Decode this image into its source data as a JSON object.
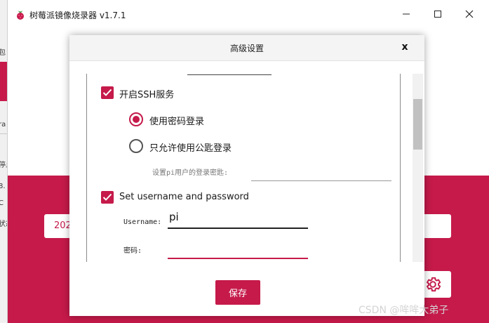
{
  "app": {
    "title": "树莓派镜像烧录器 v1.7.1",
    "icon": "raspberry-icon",
    "colors": {
      "accent": "#c51a4a",
      "background_band": "#c51a4a"
    }
  },
  "window_controls": {
    "minimize": "—",
    "maximize": "☐",
    "close": "✕"
  },
  "background": {
    "field_text": "202",
    "side_texts": [
      "包",
      "ra",
      "停止",
      "8.",
      "C",
      "状态"
    ]
  },
  "dialog": {
    "title": "高级设置",
    "close_label": "x",
    "ssh": {
      "label": "开启SSH服务",
      "checked": true,
      "options": [
        {
          "label": "使用密码登录",
          "selected": true
        },
        {
          "label": "只允许使用公匙登录",
          "selected": false
        }
      ],
      "key_label": "设置pi用户的登录密匙:",
      "key_value": ""
    },
    "user": {
      "label": "Set username and password",
      "checked": true,
      "username_label": "Username:",
      "username_value": "pi",
      "password_label": "密码:",
      "password_value": ""
    },
    "save_label": "保存"
  },
  "watermark": "CSDN @哞哞大弟子"
}
